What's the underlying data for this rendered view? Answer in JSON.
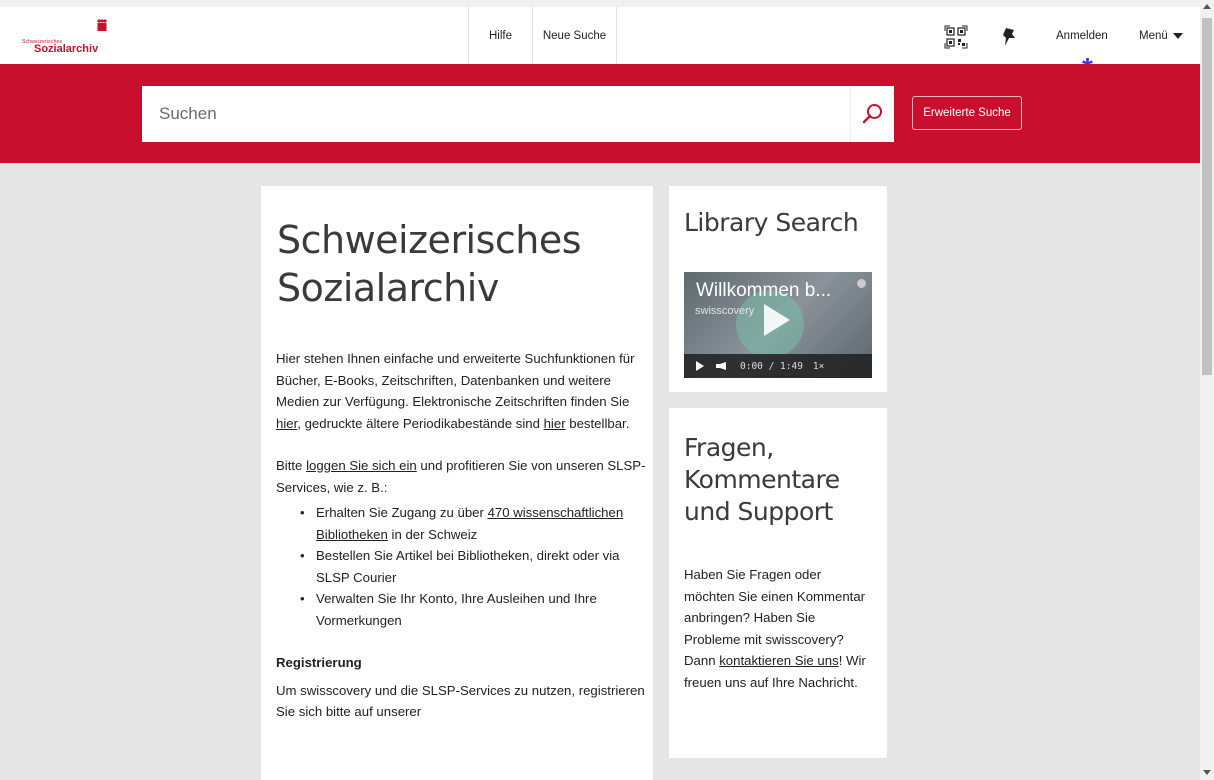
{
  "header": {
    "logo_small": "Schweizerisches",
    "logo_big": "Sozialarchiv",
    "nav": [
      "Hilfe",
      "Neue Suche"
    ],
    "login": "Anmelden",
    "menu": "Menü"
  },
  "search": {
    "placeholder": "Suchen",
    "advanced": "Erweiterte Suche"
  },
  "main": {
    "title": "Schweizerisches Sozialarchiv",
    "p1_a": "Hier stehen Ihnen einfache und erweiterte Suchfunktionen für Bücher, E-Books, Zeitschriften, Datenbanken und weitere Medien zur Verfügung. Elektronische Zeitschriften finden Sie ",
    "p1_link1": "hier",
    "p1_b": ", gedruckte ältere Periodikabestände sind ",
    "p1_link2": "hier",
    "p1_c": " bestellbar.",
    "p2_a": "Bitte ",
    "p2_link": "loggen Sie sich ein",
    "p2_b": " und profitieren Sie von unseren SLSP-Services, wie z. B.:",
    "b1_a": "Erhalten Sie Zugang zu über ",
    "b1_link": "470 wissenschaftlichen Bibliotheken",
    "b1_b": " in der Schweiz",
    "b2": "Bestellen Sie Artikel bei Bibliotheken, direkt oder via SLSP Courier",
    "b3": "Verwalten Sie Ihr Konto, Ihre Ausleihen und Ihre Vormerkungen",
    "reg_head": "Registrierung",
    "reg_text": "Um swisscovery und die SLSP-Services zu nutzen, registrieren Sie sich bitte auf unserer"
  },
  "library": {
    "title": "Library Search",
    "video_title": "Willkommen b...",
    "video_sub": "swisscovery",
    "time": "0:00 / 1:49",
    "speed": "1×"
  },
  "faq": {
    "title": "Fragen, Kommentare und Support",
    "t_a": "Haben Sie Fragen oder möchten Sie einen Kommentar anbringen? Haben Sie Probleme mit swisscovery? Dann ",
    "t_link": "kontaktieren Sie uns",
    "t_b": "! Wir freuen uns auf Ihre Nachricht."
  },
  "colors": {
    "brand_red": "#c8102e",
    "asterisk": "#3b3be6"
  },
  "icons": [
    "qr-code-icon",
    "pin-icon",
    "search-icon",
    "caret-down-icon",
    "play-icon"
  ]
}
